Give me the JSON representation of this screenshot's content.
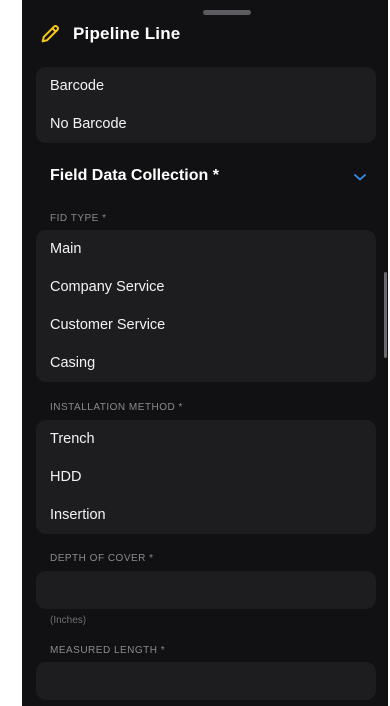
{
  "header": {
    "title": "Pipeline Line",
    "icon": "pencil-icon",
    "accent": "#f5c518"
  },
  "barcode_group": {
    "options": [
      "Barcode",
      "No Barcode"
    ]
  },
  "section": {
    "title": "Field Data Collection *",
    "chevron": "chevron-down-icon",
    "chevron_color": "#3b8ee8"
  },
  "fid_type": {
    "label": "FID TYPE *",
    "options": [
      "Main",
      "Company Service",
      "Customer Service",
      "Casing"
    ]
  },
  "installation_method": {
    "label": "INSTALLATION METHOD *",
    "options": [
      "Trench",
      "HDD",
      "Insertion"
    ]
  },
  "depth_of_cover": {
    "label": "DEPTH OF COVER *",
    "value": "",
    "hint": "(Inches)"
  },
  "measured_length": {
    "label": "MEASURED LENGTH *",
    "value": ""
  }
}
